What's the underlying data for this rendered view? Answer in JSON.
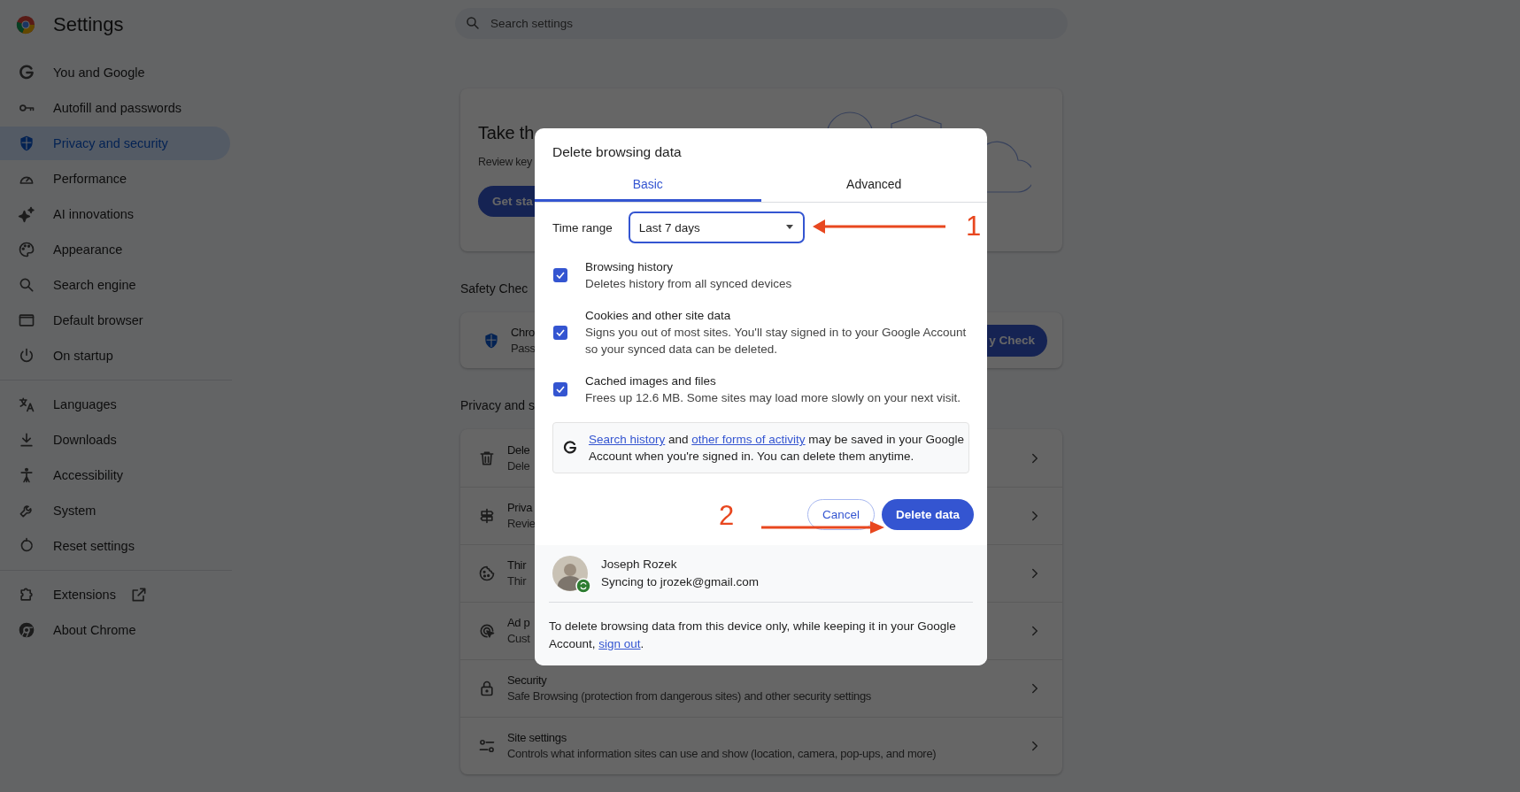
{
  "header": {
    "title": "Settings"
  },
  "search": {
    "placeholder": "Search settings"
  },
  "sidebar": {
    "groups": [
      {
        "items": [
          {
            "label": "You and Google",
            "selected": false
          },
          {
            "label": "Autofill and passwords",
            "selected": false
          },
          {
            "label": "Privacy and security",
            "selected": true
          },
          {
            "label": "Performance",
            "selected": false
          },
          {
            "label": "AI innovations",
            "selected": false
          },
          {
            "label": "Appearance",
            "selected": false
          },
          {
            "label": "Search engine",
            "selected": false
          },
          {
            "label": "Default browser",
            "selected": false
          },
          {
            "label": "On startup",
            "selected": false
          }
        ]
      },
      {
        "items": [
          {
            "label": "Languages",
            "selected": false
          },
          {
            "label": "Downloads",
            "selected": false
          },
          {
            "label": "Accessibility",
            "selected": false
          },
          {
            "label": "System",
            "selected": false
          },
          {
            "label": "Reset settings",
            "selected": false
          }
        ]
      },
      {
        "items": [
          {
            "label": "Extensions",
            "selected": false
          },
          {
            "label": "About Chrome",
            "selected": false
          }
        ]
      }
    ]
  },
  "privacy_guide_card": {
    "title": "Take th",
    "text": "Review key",
    "button": "Get sta"
  },
  "safety_check": {
    "heading": "Safety Chec",
    "title": "Chro",
    "text": "Pass",
    "button": "y Check"
  },
  "privacy_section": {
    "heading": "Privacy and s",
    "rows": [
      {
        "title": "Dele",
        "description": "Dele"
      },
      {
        "title": "Priva",
        "description": "Revie"
      },
      {
        "title": "Thir",
        "description": "Thir"
      },
      {
        "title": "Ad p",
        "description": "Cust"
      },
      {
        "title": "Security",
        "description": "Safe Browsing (protection from dangerous sites) and other security settings"
      },
      {
        "title": "Site settings",
        "description": "Controls what information sites can use and show (location, camera, pop-ups, and more)"
      }
    ]
  },
  "dialog": {
    "title": "Delete browsing data",
    "tabs": [
      {
        "label": "Basic",
        "selected": true
      },
      {
        "label": "Advanced",
        "selected": false
      }
    ],
    "time_range": {
      "label": "Time range",
      "value": "Last 7 days"
    },
    "options": [
      {
        "title": "Browsing history",
        "description": "Deletes history from all synced devices",
        "checked": true
      },
      {
        "title": "Cookies and other site data",
        "description": "Signs you out of most sites. You'll stay signed in to your Google Account so your synced data can be deleted.",
        "checked": true
      },
      {
        "title": "Cached images and files",
        "description": "Frees up 12.6 MB. Some sites may load more slowly on your next visit.",
        "checked": true
      }
    ],
    "info": [
      {
        "kind": "link",
        "text": "Search history"
      },
      {
        "kind": "plain",
        "text": " and "
      },
      {
        "kind": "link",
        "text": "other forms of activity"
      },
      {
        "kind": "plain",
        "text": " may be saved in your Google Account when you're signed in. You can delete them anytime."
      }
    ],
    "buttons": [
      {
        "kind": "secondary",
        "label": "Cancel"
      },
      {
        "kind": "primary",
        "label": "Delete data"
      }
    ],
    "account": {
      "name": "Joseph Rozek",
      "status": "Syncing to jrozek@gmail.com"
    },
    "note": [
      {
        "kind": "plain",
        "text": "To delete browsing data from this device only, while keeping it in your Google Account, "
      },
      {
        "kind": "link",
        "text": "sign out"
      },
      {
        "kind": "plain",
        "text": "."
      }
    ]
  },
  "annotations": [
    {
      "label": "1"
    },
    {
      "label": "2"
    }
  ]
}
